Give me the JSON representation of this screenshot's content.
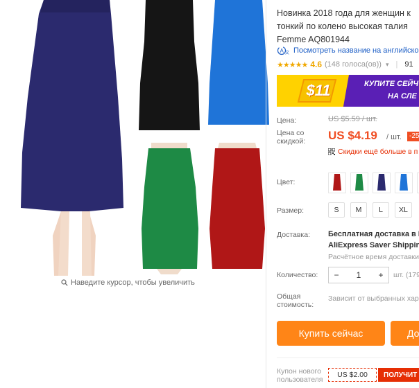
{
  "gallery": {
    "zoom_hint": "Наведите курсор, чтобы увеличить",
    "skirt_colors": {
      "navy": "#2b2a6e",
      "black": "#151515",
      "blue": "#1f74d8",
      "green": "#1e8a45",
      "red": "#b01717"
    }
  },
  "product": {
    "title_line1": "Новинка 2018 года для женщин к",
    "title_line2": "тонкий по колено высокая талия",
    "title_line3": "Femme AQ801944",
    "translate_link": "Посмотреть название на английско",
    "rating": {
      "stars": "★★★★★",
      "value": "4.6",
      "votes": "(148 голоса(ов))",
      "orders": "91"
    }
  },
  "banner": {
    "amount": "$11",
    "line1": "КУПИТЕ СЕЙЧ",
    "line2": "НА СЛЕ"
  },
  "pricing": {
    "price_label": "Цена:",
    "old_price": "US $5.59 / шт.",
    "discount_label_line1": "Цена со",
    "discount_label_line2": "скидкой:",
    "new_price": "US $4.19",
    "unit": "/ шт.",
    "discount_badge": "-25",
    "more_discounts": "Скидки ещё больше в п"
  },
  "options": {
    "color_label": "Цвет:",
    "sizes_label": "Размер:",
    "sizes": [
      "S",
      "M",
      "L",
      "XL"
    ]
  },
  "shipping": {
    "label": "Доставка:",
    "title": "Бесплатная доставка в R",
    "service": "AliExpress Saver Shipping",
    "estimate": "Расчётное время доставки"
  },
  "quantity": {
    "label": "Количество:",
    "value": "1",
    "minus": "−",
    "plus": "+",
    "available": "шт. (179"
  },
  "total": {
    "label_line1": "Общая",
    "label_line2": "стоимость:",
    "value": "Зависит от выбранных хар"
  },
  "actions": {
    "buy_now": "Купить сейчас",
    "add_to_cart": "До"
  },
  "coupon": {
    "label_line1": "Купон нового",
    "label_line2": "пользователя",
    "amount": "US $2.00",
    "get": "ПОЛУЧИТ"
  }
}
